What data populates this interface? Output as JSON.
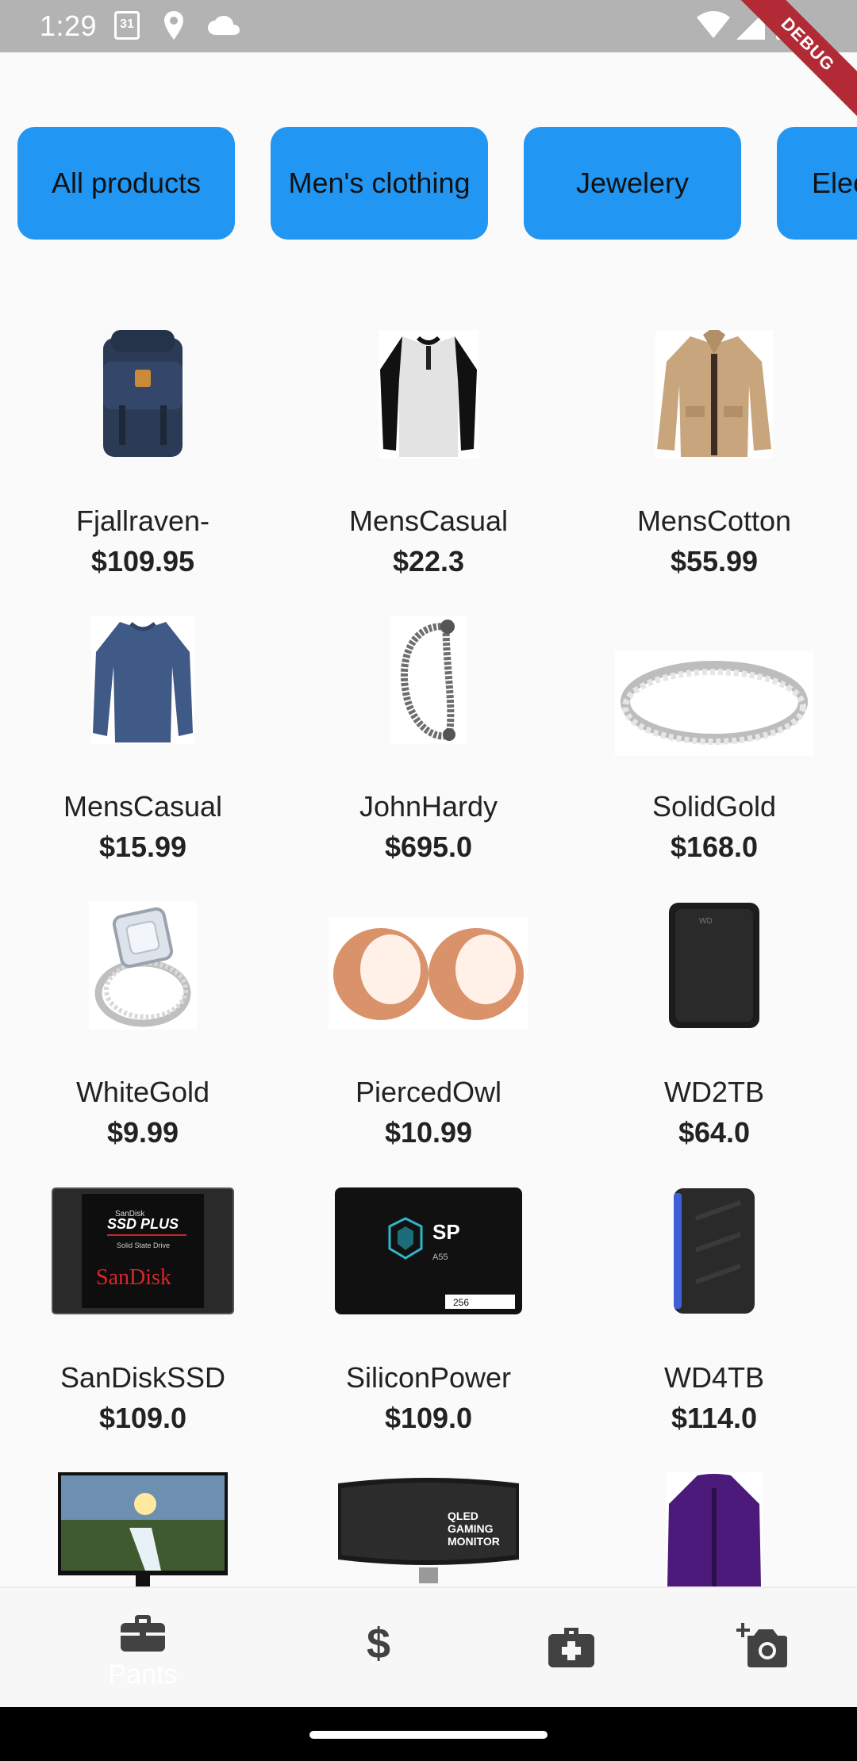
{
  "status_bar": {
    "time": "1:29",
    "calendar_day": "31",
    "icons": [
      "calendar-icon",
      "location-icon",
      "cloud-icon",
      "wifi-icon",
      "signal-icon",
      "battery-icon"
    ]
  },
  "debug_banner": "DEBUG",
  "categories": [
    {
      "label": "All products"
    },
    {
      "label": "Men's clothing"
    },
    {
      "label": "Jewelery"
    },
    {
      "label": "Electronics"
    }
  ],
  "products": [
    {
      "name": "Fjallraven-",
      "price": "$109.95",
      "image": "backpack"
    },
    {
      "name": "MensCasual",
      "price": "$22.3",
      "image": "raglan-tshirt"
    },
    {
      "name": "MensCotton",
      "price": "$55.99",
      "image": "cotton-jacket"
    },
    {
      "name": "MensCasual",
      "price": "$15.99",
      "image": "slim-fit-tshirt"
    },
    {
      "name": "JohnHardy",
      "price": "$695.0",
      "image": "dragon-bracelet"
    },
    {
      "name": "SolidGold",
      "price": "$168.0",
      "image": "gold-ring"
    },
    {
      "name": "WhiteGold",
      "price": "$9.99",
      "image": "white-gold-ring"
    },
    {
      "name": "PiercedOwl",
      "price": "$10.99",
      "image": "rose-gold-plugs"
    },
    {
      "name": "WD2TB",
      "price": "$64.0",
      "image": "wd-2tb-drive"
    },
    {
      "name": "SanDiskSSD",
      "price": "$109.0",
      "image": "sandisk-ssd"
    },
    {
      "name": "SiliconPower",
      "price": "$109.0",
      "image": "silicon-power-ssd"
    },
    {
      "name": "WD4TB",
      "price": "$114.0",
      "image": "wd-4tb-drive"
    },
    {
      "name": "",
      "price": "",
      "image": "acer-monitor"
    },
    {
      "name": "",
      "price": "",
      "image": "samsung-gaming-monitor"
    },
    {
      "name": "",
      "price": "",
      "image": "purple-snow-jacket"
    }
  ],
  "sandisk_labels": {
    "line1": "SanDisk",
    "line2": "SSD PLUS",
    "line3": "Solid State Drive",
    "brand": "SanDisk"
  },
  "silicon_labels": {
    "brand": "SP",
    "model": "A55",
    "capacity": "256"
  },
  "monitor_labels": {
    "line1": "QLED",
    "line2": "GAMING",
    "line3": "MONITOR"
  },
  "bottom_nav": [
    {
      "label": "Pants",
      "icon": "briefcase-icon"
    },
    {
      "label": "",
      "icon": "dollar-icon"
    },
    {
      "label": "",
      "icon": "medical-case-icon"
    },
    {
      "label": "",
      "icon": "add-camera-icon"
    }
  ],
  "colors": {
    "chip_bg": "#2196f3",
    "status_bar_bg": "#b3b3b3",
    "debug_ribbon": "#b22a35",
    "nav_icon": "#424242"
  }
}
